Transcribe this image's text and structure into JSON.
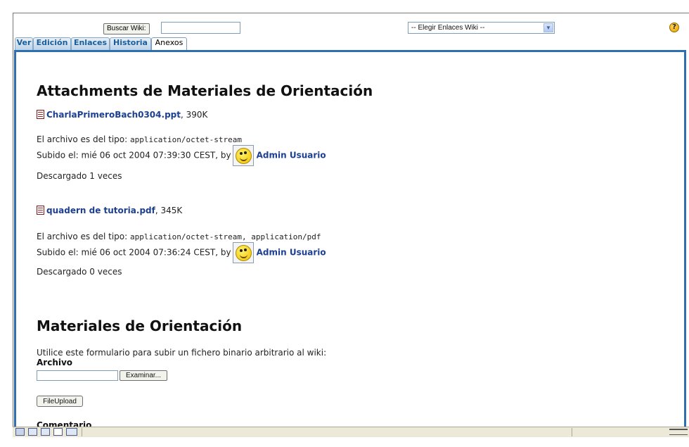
{
  "search": {
    "button_label": "Buscar Wiki:",
    "input_value": ""
  },
  "links_select": {
    "selected": "-- Elegir Enlaces Wiki --"
  },
  "help": {
    "glyph": "?",
    "icon": "help-icon"
  },
  "tabs": [
    {
      "label": "Ver",
      "active": false
    },
    {
      "label": "Edición",
      "active": false
    },
    {
      "label": "Enlaces",
      "active": false
    },
    {
      "label": "Historia",
      "active": false
    },
    {
      "label": "Anexos",
      "active": true
    }
  ],
  "attachments": {
    "heading": "Attachments de Materiales de Orientación",
    "items": [
      {
        "file_name": "CharlaPrimeroBach0304.ppt",
        "size": ", 390K",
        "type_label": "El archivo es del tipo: ",
        "type_value": "application/octet-stream",
        "uploaded_label": "Subido el: mié 06 oct 2004 07:39:30 CEST, by",
        "user": "Admin Usuario",
        "downloads": "Descargado 1 veces"
      },
      {
        "file_name": "quadern de tutoria.pdf",
        "size": ", 345K",
        "type_label": "El archivo es del tipo: ",
        "type_value": "application/octet-stream, application/pdf",
        "uploaded_label": "Subido el: mié 06 oct 2004 07:36:24 CEST, by",
        "user": "Admin Usuario",
        "downloads": "Descargado 0 veces"
      }
    ]
  },
  "upload": {
    "heading": "Materiales de Orientación",
    "instructions": "Utilice este formulario para subir un fichero binario arbitrario al wiki:",
    "file_label": "Archivo",
    "browse_label": "Examinar...",
    "submit_label": "FileUpload",
    "comment_label": "Comentario"
  },
  "colors": {
    "tab_border": "#2f6fb0",
    "link": "#1d3f92",
    "tab_text": "#1a5e9a"
  }
}
